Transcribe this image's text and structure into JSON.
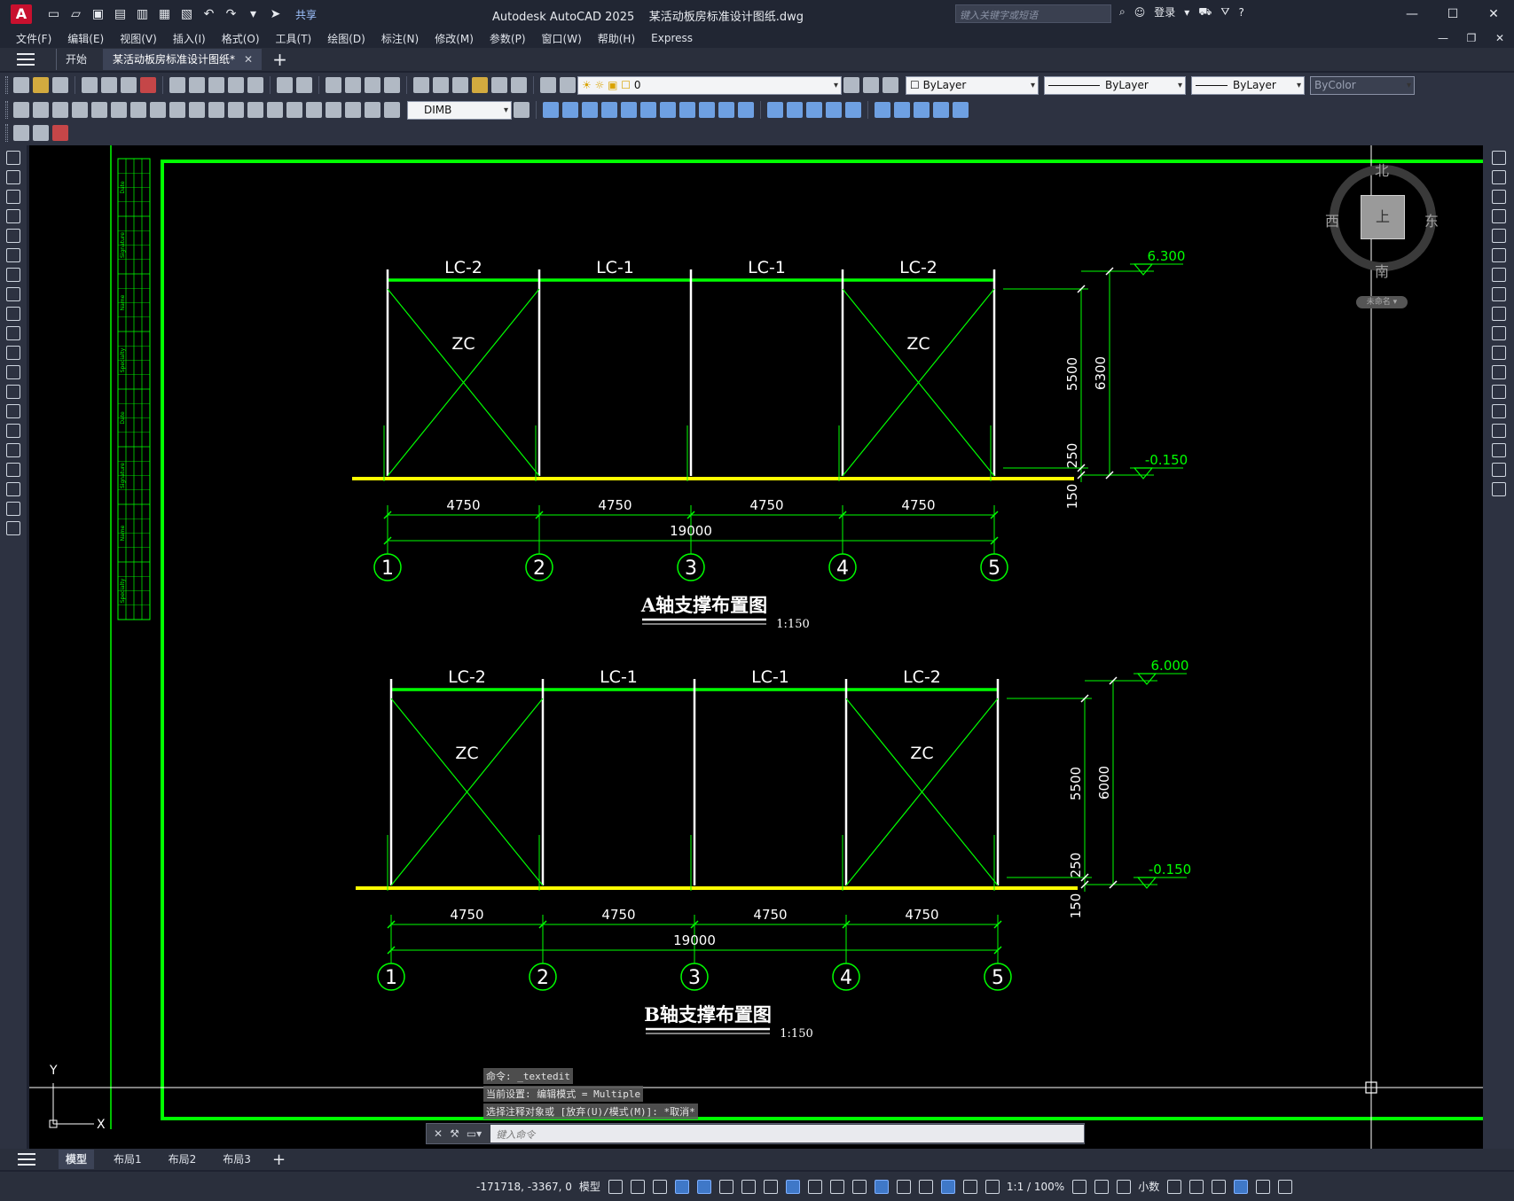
{
  "titlebar": {
    "app_name": "Autodesk AutoCAD 2025",
    "file_name": "某活动板房标准设计图纸.dwg",
    "share_label": "共享",
    "search_placeholder": "键入关键字或短语",
    "login_label": "登录"
  },
  "menu": [
    "文件(F)",
    "编辑(E)",
    "视图(V)",
    "插入(I)",
    "格式(O)",
    "工具(T)",
    "绘图(D)",
    "标注(N)",
    "修改(M)",
    "参数(P)",
    "窗口(W)",
    "帮助(H)",
    "Express"
  ],
  "file_tabs": {
    "start": "开始",
    "active": "某活动板房标准设计图纸*"
  },
  "properties": {
    "layer": "0",
    "color": "ByLayer",
    "linetype": "ByLayer",
    "lineweight": "ByLayer",
    "plotstyle": "ByColor",
    "dimstyle": "DIMB"
  },
  "viewcube": {
    "north": "北",
    "south": "南",
    "east": "东",
    "west": "西",
    "top": "上",
    "wcs": "未命名"
  },
  "drawing": {
    "colors": {
      "frame": "#00ff00",
      "ground": "#ffff00",
      "column": "#ffffff",
      "dim": "#00ff00",
      "text": "#ffffff"
    },
    "ucs": {
      "x": "X",
      "y": "Y"
    },
    "views": [
      {
        "title": "A轴支撑布置图",
        "scale": "1:150",
        "bays": [
          "LC-2",
          "LC-1",
          "LC-1",
          "LC-2"
        ],
        "braced_label": "ZC",
        "bay_dims": [
          "4750",
          "4750",
          "4750",
          "4750"
        ],
        "total_dim": "19000",
        "axes": [
          "1",
          "2",
          "3",
          "4",
          "5"
        ],
        "top_elev": "6.300",
        "bottom_elev": "-0.150",
        "vert_dims": [
          "5500",
          "6300",
          "250",
          "150"
        ]
      },
      {
        "title": "B轴支撑布置图",
        "scale": "1:150",
        "bays": [
          "LC-2",
          "LC-1",
          "LC-1",
          "LC-2"
        ],
        "braced_label": "ZC",
        "bay_dims": [
          "4750",
          "4750",
          "4750",
          "4750"
        ],
        "total_dim": "19000",
        "axes": [
          "1",
          "2",
          "3",
          "4",
          "5"
        ],
        "top_elev": "6.000",
        "bottom_elev": "-0.150",
        "vert_dims": [
          "5500",
          "6000",
          "250",
          "150"
        ]
      }
    ],
    "titleblock_cols": [
      "Date",
      "Signature",
      "Name",
      "Specialty",
      "Date",
      "Signature",
      "Name",
      "Specialty"
    ]
  },
  "command_history": [
    "命令: _textedit",
    "当前设置: 编辑模式 = Multiple",
    "选择注释对象或 [放弃(U)/模式(M)]: *取消*"
  ],
  "command_placeholder": "键入命令",
  "layout_tabs": [
    "模型",
    "布局1",
    "布局2",
    "布局3"
  ],
  "status": {
    "coords": "-171718, -3367, 0",
    "model": "模型",
    "scale": "1:1 / 100%",
    "units": "小数"
  }
}
